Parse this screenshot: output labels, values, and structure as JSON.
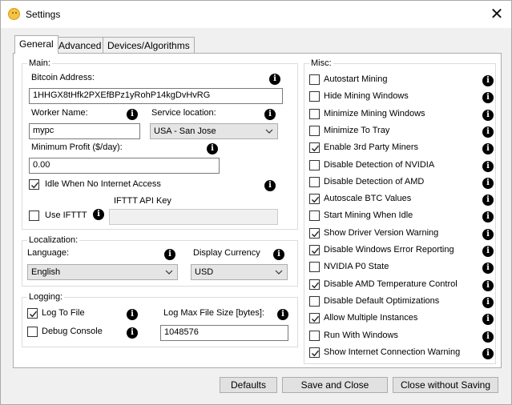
{
  "window": {
    "title": "Settings",
    "close_glyph": "✕",
    "icon": "app-coin-icon"
  },
  "tabs": [
    {
      "label": "General",
      "active": true
    },
    {
      "label": "Advanced",
      "active": false
    },
    {
      "label": "Devices/Algorithms",
      "active": false
    }
  ],
  "main": {
    "legend": "Main:",
    "bitcoin_address_label": "Bitcoin Address:",
    "bitcoin_address_value": "1HHGX8tHfk2PXEfBPz1yRohP14kgDvHvRG",
    "worker_name_label": "Worker Name:",
    "worker_name_value": "mypc",
    "service_location_label": "Service location:",
    "service_location_value": "USA - San Jose",
    "min_profit_label": "Minimum Profit ($/day):",
    "min_profit_value": "0.00",
    "idle_label": "Idle When No Internet Access",
    "idle_checked": true,
    "ifttt_api_key_label": "IFTTT API Key",
    "ifttt_api_key_value": "",
    "use_ifttt_label": "Use IFTTT",
    "use_ifttt_checked": false
  },
  "localization": {
    "legend": "Localization:",
    "language_label": "Language:",
    "language_value": "English",
    "currency_label": "Display Currency",
    "currency_value": "USD"
  },
  "logging": {
    "legend": "Logging:",
    "log_to_file_label": "Log To File",
    "log_to_file_checked": true,
    "debug_console_label": "Debug Console",
    "debug_console_checked": false,
    "max_size_label": "Log Max File Size [bytes]:",
    "max_size_value": "1048576"
  },
  "misc": {
    "legend": "Misc:",
    "items": [
      {
        "label": "Autostart Mining",
        "checked": false
      },
      {
        "label": "Hide Mining Windows",
        "checked": false
      },
      {
        "label": "Minimize Mining Windows",
        "checked": false
      },
      {
        "label": "Minimize To Tray",
        "checked": false
      },
      {
        "label": "Enable 3rd Party Miners",
        "checked": true
      },
      {
        "label": "Disable Detection of NVIDIA",
        "checked": false
      },
      {
        "label": "Disable Detection of AMD",
        "checked": false
      },
      {
        "label": "Autoscale BTC Values",
        "checked": true
      },
      {
        "label": "Start Mining When Idle",
        "checked": false
      },
      {
        "label": "Show Driver Version Warning",
        "checked": true
      },
      {
        "label": "Disable Windows Error Reporting",
        "checked": true
      },
      {
        "label": "NVIDIA P0 State",
        "checked": false
      },
      {
        "label": "Disable AMD Temperature Control",
        "checked": true
      },
      {
        "label": "Disable Default Optimizations",
        "checked": false
      },
      {
        "label": "Allow Multiple Instances",
        "checked": true
      },
      {
        "label": "Run With Windows",
        "checked": false
      },
      {
        "label": "Show Internet Connection Warning",
        "checked": true
      }
    ]
  },
  "buttons": {
    "defaults": "Defaults",
    "save_close": "Save and Close",
    "close_no_save": "Close without Saving"
  },
  "icons": {
    "info": "info-icon",
    "glyph": "i"
  }
}
